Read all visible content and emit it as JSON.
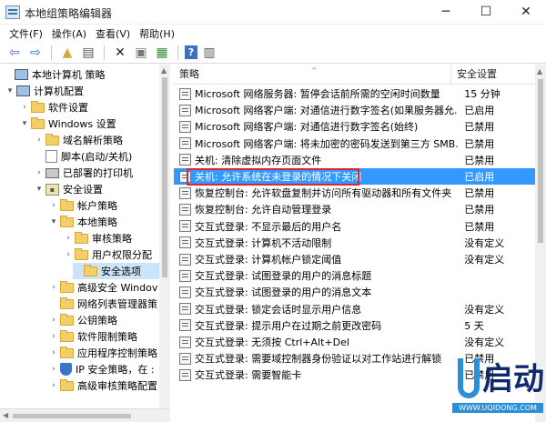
{
  "window": {
    "title": "本地组策略编辑器",
    "minimize": "─",
    "maximize": "☐",
    "close": "✕"
  },
  "menu": [
    "文件(F)",
    "操作(A)",
    "查看(V)",
    "帮助(H)"
  ],
  "toolbar": [
    {
      "name": "back-arrow-icon",
      "glyph": "⇦"
    },
    {
      "name": "forward-arrow-icon",
      "glyph": "⇨"
    },
    {
      "name": "up-folder-icon",
      "glyph": "▲"
    },
    {
      "name": "show-hide-tree-icon",
      "glyph": "▤"
    },
    {
      "name": "delete-icon",
      "glyph": "✕"
    },
    {
      "name": "properties-icon",
      "glyph": "▣"
    },
    {
      "name": "export-list-icon",
      "glyph": "▦"
    },
    {
      "name": "help-icon",
      "glyph": "?"
    },
    {
      "name": "toggle-pane-icon",
      "glyph": "▥"
    }
  ],
  "tree": [
    {
      "label": "本地计算机 策略",
      "toggle": "",
      "icon": "pc"
    },
    {
      "label": "计算机配置",
      "toggle": "▾",
      "icon": "pc"
    },
    {
      "label": "软件设置",
      "toggle": "›",
      "icon": "folder"
    },
    {
      "label": "Windows 设置",
      "toggle": "▾",
      "icon": "folder"
    },
    {
      "label": "域名解析策略",
      "toggle": "›",
      "icon": "folder"
    },
    {
      "label": "脚本(启动/关机)",
      "toggle": "",
      "icon": "doc"
    },
    {
      "label": "已部署的打印机",
      "toggle": "›",
      "icon": "printer"
    },
    {
      "label": "安全设置",
      "toggle": "▾",
      "icon": "lock"
    },
    {
      "label": "帐户策略",
      "toggle": "›",
      "icon": "folder"
    },
    {
      "label": "本地策略",
      "toggle": "▾",
      "icon": "folder"
    },
    {
      "label": "审核策略",
      "toggle": "›",
      "icon": "folder"
    },
    {
      "label": "用户权限分配",
      "toggle": "›",
      "icon": "folder"
    },
    {
      "label": "安全选项",
      "toggle": "",
      "icon": "folder"
    },
    {
      "label": "高级安全 Windov",
      "toggle": "›",
      "icon": "folder"
    },
    {
      "label": "网络列表管理器策",
      "toggle": "",
      "icon": "folder"
    },
    {
      "label": "公钥策略",
      "toggle": "›",
      "icon": "folder"
    },
    {
      "label": "软件限制策略",
      "toggle": "›",
      "icon": "folder"
    },
    {
      "label": "应用程序控制策略",
      "toggle": "›",
      "icon": "folder"
    },
    {
      "label": "IP 安全策略，在 :",
      "toggle": "›",
      "icon": "shield"
    },
    {
      "label": "高级审核策略配置",
      "toggle": "›",
      "icon": "folder"
    }
  ],
  "list": {
    "col_policy": "策略",
    "col_setting": "安全设置",
    "rows": [
      {
        "name": "Microsoft 网络服务器: 暂停会话前所需的空闲时间数量",
        "value": "15 分钟"
      },
      {
        "name": "Microsoft 网络客户端: 对通信进行数字签名(如果服务器允...",
        "value": "已启用"
      },
      {
        "name": "Microsoft 网络客户端: 对通信进行数字签名(始终)",
        "value": "已禁用"
      },
      {
        "name": "Microsoft 网络客户端: 将未加密的密码发送到第三方 SMB...",
        "value": "已禁用"
      },
      {
        "name": "关机: 清除虚拟内存页面文件",
        "value": "已禁用"
      },
      {
        "name": "关机: 允许系统在未登录的情况下关闭",
        "value": "已启用"
      },
      {
        "name": "恢复控制台: 允许软盘复制并访问所有驱动器和所有文件夹",
        "value": "已禁用"
      },
      {
        "name": "恢复控制台: 允许自动管理登录",
        "value": "已禁用"
      },
      {
        "name": "交互式登录: 不显示最后的用户名",
        "value": "已禁用"
      },
      {
        "name": "交互式登录: 计算机不活动限制",
        "value": "没有定义"
      },
      {
        "name": "交互式登录: 计算机帐户锁定阈值",
        "value": "没有定义"
      },
      {
        "name": "交互式登录: 试图登录的用户的消息标题",
        "value": ""
      },
      {
        "name": "交互式登录: 试图登录的用户的消息文本",
        "value": ""
      },
      {
        "name": "交互式登录: 锁定会话时显示用户信息",
        "value": "没有定义"
      },
      {
        "name": "交互式登录: 提示用户在过期之前更改密码",
        "value": "5 天"
      },
      {
        "name": "交互式登录: 无须按 Ctrl+Alt+Del",
        "value": "没有定义"
      },
      {
        "name": "交互式登录: 需要域控制器身份验证以对工作站进行解锁",
        "value": "已禁用"
      },
      {
        "name": "交互式登录: 需要智能卡",
        "value": "已禁用"
      }
    ]
  },
  "watermark": {
    "brand": "启动",
    "url": "WWW.UQIDONG.COM"
  }
}
